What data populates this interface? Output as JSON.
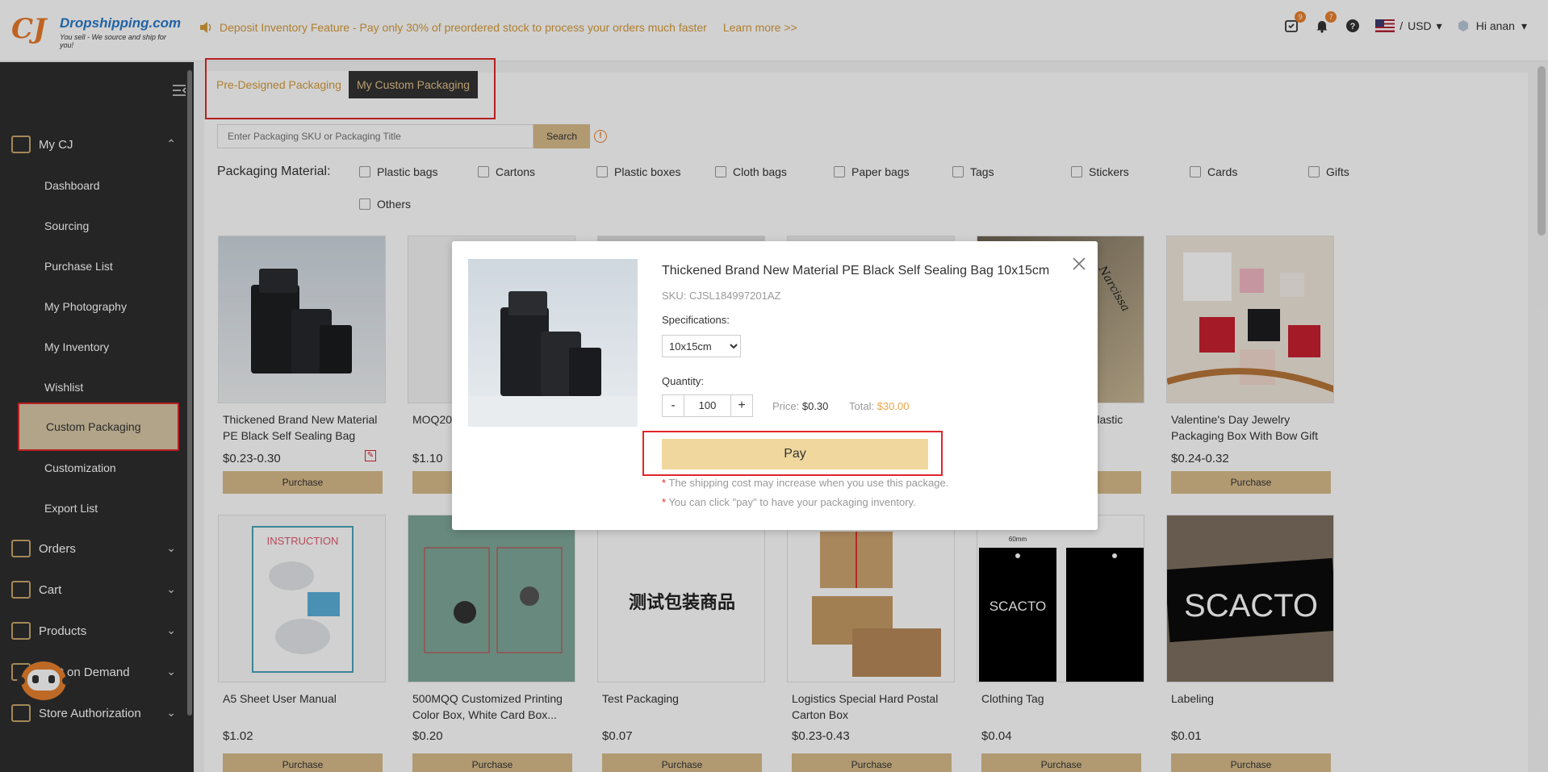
{
  "header": {
    "brand": "Dropshipping.com",
    "tagline": "You sell - We source and ship for you!",
    "notice": "Deposit Inventory Feature - Pay only 30% of preordered stock to process your orders much faster",
    "learn_more": "Learn more >>",
    "badge_tasks": "9",
    "badge_notify": "7",
    "currency": "USD",
    "greeting": "Hi anan"
  },
  "sidebar": {
    "groups": [
      {
        "label": "My CJ"
      },
      {
        "label": "Orders"
      },
      {
        "label": "Cart"
      },
      {
        "label": "Products"
      },
      {
        "label": "Print on Demand"
      },
      {
        "label": "Store Authorization"
      }
    ],
    "items": [
      {
        "label": "Dashboard"
      },
      {
        "label": "Sourcing"
      },
      {
        "label": "Purchase List"
      },
      {
        "label": "My Photography"
      },
      {
        "label": "My Inventory"
      },
      {
        "label": "Wishlist"
      },
      {
        "label": "Custom Packaging"
      },
      {
        "label": "Customization"
      },
      {
        "label": "Export List"
      }
    ]
  },
  "tabs": {
    "pre": "Pre-Designed Packaging",
    "my": "My Custom Packaging"
  },
  "search": {
    "placeholder": "Enter Packaging SKU or Packaging Title",
    "button": "Search"
  },
  "filters": {
    "label": "Packaging Material:",
    "options": [
      "Plastic bags",
      "Cartons",
      "Plastic boxes",
      "Cloth bags",
      "Paper bags",
      "Tags",
      "Stickers",
      "Cards",
      "Gifts",
      "Others"
    ]
  },
  "products": [
    {
      "title": "Thickened Brand New Material PE Black Self Sealing Bag",
      "price": "$0.23-0.30"
    },
    {
      "title": "MOQ20 Box",
      "price": "$1.10"
    },
    {
      "title": "",
      "price": ""
    },
    {
      "title": "",
      "price": ""
    },
    {
      "title": "Plastic",
      "price": ""
    },
    {
      "title": "Valentine's Day Jewelry Packaging Box With Bow Gift",
      "price": "$0.24-0.32"
    },
    {
      "title": "A5 Sheet User Manual",
      "price": "$1.02"
    },
    {
      "title": "500MQQ Customized Printing Color Box, White Card Box...",
      "price": "$0.20"
    },
    {
      "title": "Test Packaging",
      "price": "$0.07"
    },
    {
      "title": "Logistics Special Hard Postal Carton Box",
      "price": "$0.23-0.43"
    },
    {
      "title": "Clothing Tag",
      "price": "$0.04"
    },
    {
      "title": "Labeling",
      "price": "$0.01"
    }
  ],
  "purchase_label": "Purchase",
  "card_text": {
    "instruction": "INSTRUCTION",
    "test_cn": "测试包装商品",
    "scacto": "SCACTO",
    "mm60": "60mm",
    "narcissa": "Narcissa"
  },
  "modal": {
    "title": "Thickened Brand New Material PE Black Self Sealing Bag 10x15cm",
    "sku": "SKU: CJSL184997201AZ",
    "spec_label": "Specifications:",
    "spec_value": "10x15cm",
    "qty_label": "Quantity:",
    "qty_value": "100",
    "minus": "-",
    "plus": "+",
    "price_label": "Price:",
    "price_value": "$0.30",
    "total_label": "Total:",
    "total_value": "$30.00",
    "pay": "Pay",
    "note1": "The shipping cost may increase when you use this package.",
    "note2": "You can click \"pay\" to have your packaging inventory.",
    "star": "*"
  }
}
